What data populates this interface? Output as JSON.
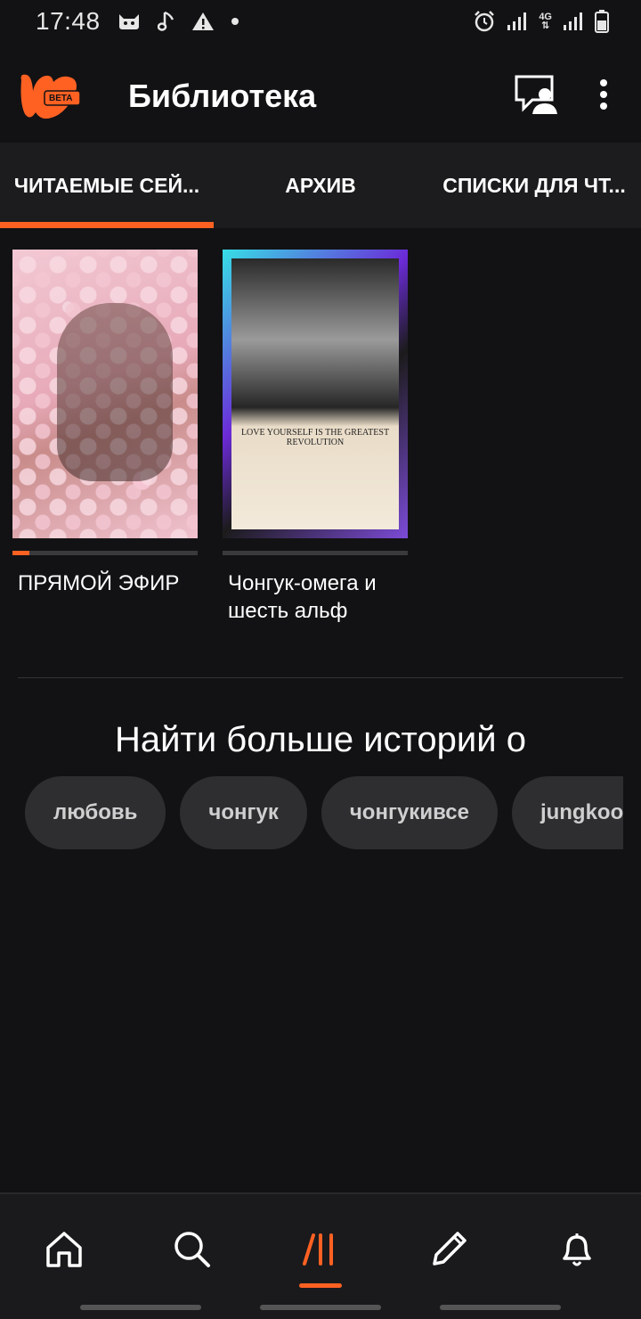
{
  "status_bar": {
    "time": "17:48",
    "left_icons": [
      "cat-icon",
      "music-note-icon",
      "warning-icon",
      "dot-icon"
    ],
    "right_icons": [
      "alarm-icon",
      "signal-icon",
      "network-4g-icon",
      "signal-icon",
      "battery-icon"
    ],
    "network_label": "4G"
  },
  "header": {
    "title": "Библиотека",
    "logo_badge": "BETA",
    "actions": [
      "reading-mode-icon",
      "more-vertical-icon"
    ]
  },
  "tabs": [
    {
      "label": "ЧИТАЕМЫЕ СЕЙ...",
      "active": true
    },
    {
      "label": "АРХИВ",
      "active": false
    },
    {
      "label": "СПИСКИ ДЛЯ ЧТ...",
      "active": false
    }
  ],
  "stories": [
    {
      "title": "ПРЯМОЙ ЭФИР",
      "progress": 0.09
    },
    {
      "title": "Чонгук-омега и шесть альф",
      "progress": 0.0,
      "cover_text": "LOVE YOURSELF IS THE GREATEST REVOLUTION"
    }
  ],
  "discover": {
    "heading": "Найти больше историй о",
    "tags": [
      "любовь",
      "чонгук",
      "чонгукивсе",
      "jungkook"
    ]
  },
  "bottom_nav": {
    "items": [
      "home-icon",
      "search-icon",
      "library-icon",
      "write-icon",
      "notifications-icon"
    ],
    "active": "library-icon"
  },
  "colors": {
    "accent": "#ff6122",
    "background": "#121214",
    "tab_bar": "#1c1c1e",
    "chip": "#2e2e30"
  }
}
